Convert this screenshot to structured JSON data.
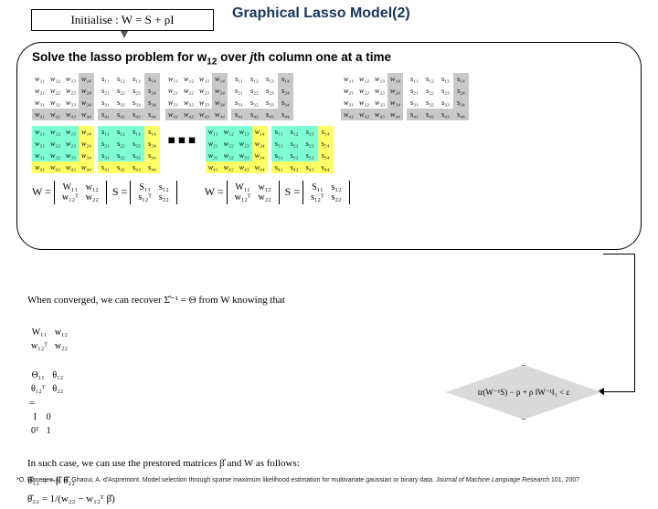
{
  "header": {
    "init_formula": "Initialise : W = S + ρI",
    "title": "Graphical Lasso Model(2)"
  },
  "panel": {
    "title_pre": "Solve the lasso problem for w",
    "title_sub": "12",
    "title_mid": " over ",
    "title_ital": "j",
    "title_post": "th column one at a time",
    "ellipsis": "▪▪▪",
    "w_label": "W =",
    "s_label": "S =",
    "W11": "W₁₁",
    "w12": "w₁₂",
    "w12T": "w₁₂ᵀ",
    "w22": "w₂₂",
    "S11": "S₁₁",
    "s12": "s₁₂",
    "s12T": "s₁₂ᵀ",
    "s22": "s₂₂"
  },
  "matrices": {
    "W": [
      [
        "w₁₁",
        "w₁₂",
        "w₁₃",
        "w₁₄"
      ],
      [
        "w₂₁",
        "w₂₂",
        "w₂₃",
        "w₂₄"
      ],
      [
        "w₃₁",
        "w₃₂",
        "w₃₃",
        "w₃₄"
      ],
      [
        "w₄₁",
        "w₄₂",
        "w₄₃",
        "w₄₄"
      ]
    ],
    "S": [
      [
        "s₁₁",
        "s₁₂",
        "s₁₃",
        "s₁₄"
      ],
      [
        "s₂₁",
        "s₂₂",
        "s₂₃",
        "s₂₄"
      ],
      [
        "s₃₁",
        "s₃₂",
        "s₃₃",
        "s₃₄"
      ],
      [
        "s₄₁",
        "s₄₂",
        "s₄₃",
        "s₄₄"
      ]
    ]
  },
  "converge": {
    "line1": "When converged, we can recover Σ̂⁻¹ = Θ from W knowing that",
    "eq_a": "W₁₁",
    "eq_b": "w₁₂",
    "eq_c": "w₁₂ᵀ",
    "eq_d": "w₂₂",
    "eq_e": "Θ₁₁",
    "eq_f": "θ₁₂",
    "eq_g": "θ₁₂ᵀ",
    "eq_h": "θ₂₂",
    "eq_I": "I",
    "eq_0": "0",
    "eq_0T": "0ᵀ",
    "eq_1": "1",
    "line2": "In such case, we can use the prestored matrices β̂ and W as follows:",
    "theta12": "θ̂₁₂ = −β̂ θ̂₂₂",
    "theta22": "θ̂₂₂ = 1/(w₂₂ − w₁₂ᵀ β̂)"
  },
  "diamond": {
    "formula": "tr(W⁻¹S) − p + ρ ‖W⁻¹‖₁ < ε"
  },
  "citation": {
    "text_pre": "*O. Banerjee, L. E. Ghaoui, A. d'Aspremont. Model selection through sparse maximum likelihood estimation for multivariate gaussian or binary data. ",
    "journal": "Journal of Machine Language Research",
    "text_post": " 101, 2007"
  }
}
